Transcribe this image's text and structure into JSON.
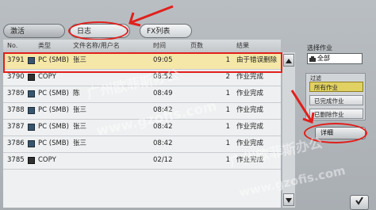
{
  "tabs": {
    "active": "激活",
    "log": "日志",
    "fax": "FX列表"
  },
  "columns": {
    "no": "No.",
    "type": "类型",
    "user": "文件名称/用户名",
    "time": "时间",
    "pages": "页数",
    "result": "结果"
  },
  "rows": [
    {
      "no": "3791",
      "icon": "pc-icon",
      "type": "PC (SMB)",
      "user": "张三",
      "time": "09:05",
      "pages": "1",
      "result": "由于错误删除"
    },
    {
      "no": "3790",
      "icon": "copy-icon",
      "type": "COPY",
      "user": "",
      "time": "08:52",
      "pages": "2",
      "result": "作业完成"
    },
    {
      "no": "3789",
      "icon": "pc-icon",
      "type": "PC (SMB)",
      "user": "陈",
      "time": "08:49",
      "pages": "1",
      "result": "作业完成"
    },
    {
      "no": "3788",
      "icon": "pc-icon",
      "type": "PC (SMB)",
      "user": "张三",
      "time": "08:42",
      "pages": "1",
      "result": "作业完成"
    },
    {
      "no": "3787",
      "icon": "pc-icon",
      "type": "PC (SMB)",
      "user": "张三",
      "time": "08:42",
      "pages": "1",
      "result": "作业完成"
    },
    {
      "no": "3786",
      "icon": "pc-icon",
      "type": "PC (SMB)",
      "user": "张三",
      "time": "08:42",
      "pages": "1",
      "result": "作业完成"
    },
    {
      "no": "3785",
      "icon": "copy-icon",
      "type": "COPY",
      "user": "",
      "time": "02/12",
      "pages": "1",
      "result": "作业完成"
    }
  ],
  "right": {
    "select_job_label": "选择作业",
    "select_value": "全部",
    "filter_label": "过滤",
    "filters": [
      "所有作业",
      "已完成作业",
      "已删除作业"
    ],
    "active_filter": "所有作业",
    "detail_label": "详细"
  },
  "watermark": {
    "cn": "广州欧菲斯办公",
    "url": "www.gzofis.com"
  },
  "colors": {
    "highlight": "#e0201c",
    "selected_row": "#f4e7a7",
    "active_filter": "#e1d163"
  }
}
